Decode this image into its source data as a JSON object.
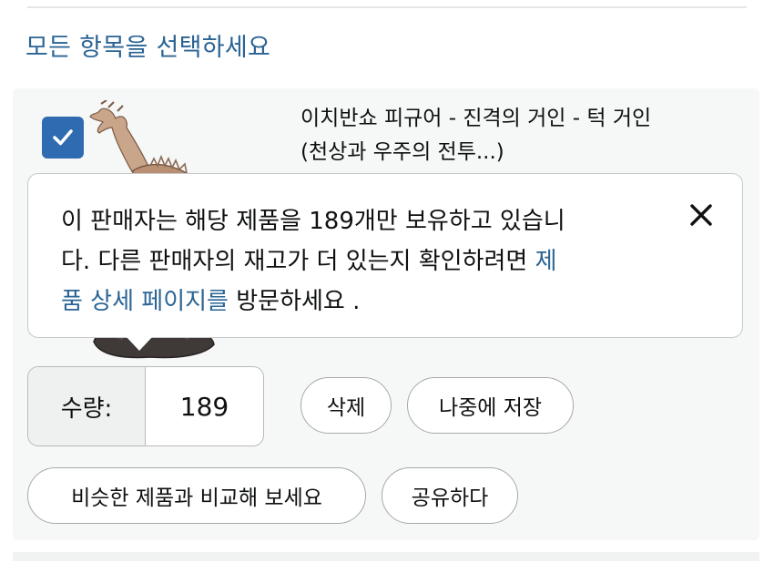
{
  "header": {
    "select_all": "모든 항목을 선택하세요"
  },
  "item": {
    "checked": true,
    "title_line1": "이치반쇼 피규어 - 진격의 거인 - 턱 거인",
    "title_line2": "(천상과 우주의 전투...)",
    "image_icon": "titan-figure-image"
  },
  "tooltip": {
    "text_line1": "이 판매자는 해당 제품을 189개만 보유하고 있습니",
    "text_line2_prefix": "다. 다른 판매자의 재고가 더 있는지 확인하려면 ",
    "link_part1": "제",
    "link_part2": "품 상세 페이지를",
    "text_suffix": " 방문하세요 .",
    "close_icon": "close-icon"
  },
  "quantity": {
    "label": "수량:",
    "value": "189"
  },
  "actions": {
    "delete": "삭제",
    "save_for_later": "나중에 저장",
    "compare": "비슷한 제품과 비교해 보세요",
    "share": "공유하다"
  },
  "colors": {
    "link": "#2a6494",
    "checkbox": "#2f6bb0",
    "card_bg": "#f6f7f7"
  }
}
